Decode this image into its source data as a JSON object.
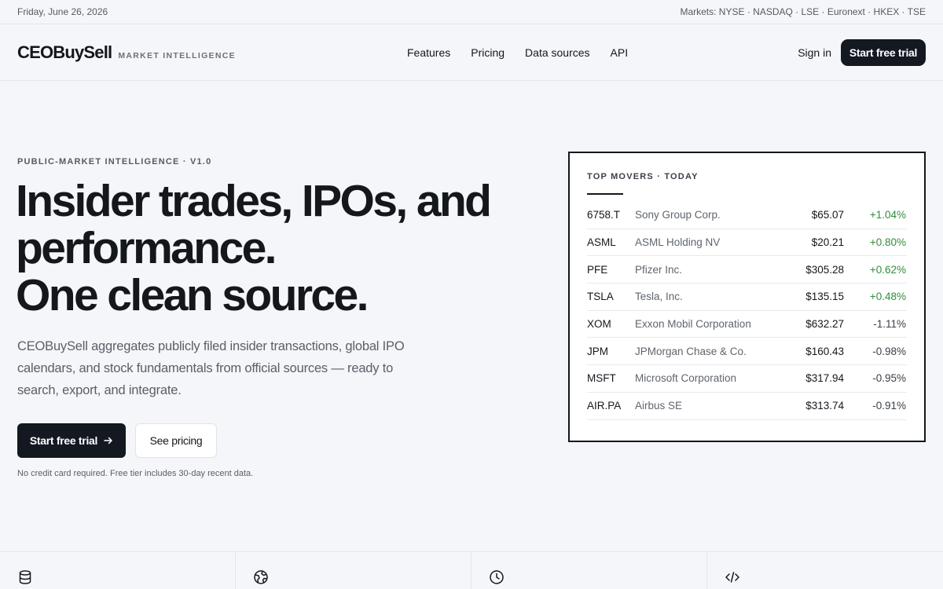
{
  "topbar": {
    "date": "Friday, June 26, 2026",
    "markets": "Markets: NYSE · NASDAQ · LSE · Euronext · HKEX · TSE"
  },
  "header": {
    "logo": "CEOBuySell",
    "tagline": "MARKET INTELLIGENCE",
    "nav": [
      "Features",
      "Pricing",
      "Data sources",
      "API"
    ],
    "signin": "Sign in",
    "cta": "Start free trial"
  },
  "hero": {
    "eyebrow": "PUBLIC-MARKET INTELLIGENCE · V1.0",
    "title_lines": [
      "Insider trades, IPOs, and",
      "performance.",
      "One clean source."
    ],
    "description": "CEOBuySell aggregates publicly filed insider transactions, global IPO calendars, and stock fundamentals from official sources — ready to search, export, and integrate.",
    "primary_cta": "Start free trial",
    "secondary_cta": "See pricing",
    "fineprint": "No credit card required. Free tier includes 30-day recent data."
  },
  "movers": {
    "title": "TOP MOVERS · TODAY",
    "rows": [
      {
        "ticker": "6758.T",
        "name": "Sony Group Corp.",
        "price": "$65.07",
        "change": "+1.04%",
        "direction": "up"
      },
      {
        "ticker": "ASML",
        "name": "ASML Holding NV",
        "price": "$20.21",
        "change": "+0.80%",
        "direction": "up"
      },
      {
        "ticker": "PFE",
        "name": "Pfizer Inc.",
        "price": "$305.28",
        "change": "+0.62%",
        "direction": "up"
      },
      {
        "ticker": "TSLA",
        "name": "Tesla, Inc.",
        "price": "$135.15",
        "change": "+0.48%",
        "direction": "up"
      },
      {
        "ticker": "XOM",
        "name": "Exxon Mobil Corporation",
        "price": "$632.27",
        "change": "-1.11%",
        "direction": "down"
      },
      {
        "ticker": "JPM",
        "name": "JPMorgan Chase & Co.",
        "price": "$160.43",
        "change": "-0.98%",
        "direction": "down"
      },
      {
        "ticker": "MSFT",
        "name": "Microsoft Corporation",
        "price": "$317.94",
        "change": "-0.95%",
        "direction": "down"
      },
      {
        "ticker": "AIR.PA",
        "name": "Airbus SE",
        "price": "$313.74",
        "change": "-0.91%",
        "direction": "down"
      }
    ]
  },
  "features": {
    "icons": [
      "database-icon",
      "globe-icon",
      "clock-icon",
      "code-icon"
    ]
  },
  "colors": {
    "primary": "#131821",
    "background": "#f4f6f9",
    "positive": "#2f8f3a"
  }
}
